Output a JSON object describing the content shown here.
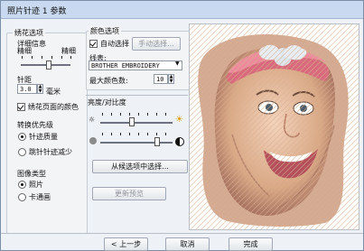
{
  "window": {
    "title": "照片针迹 1 参数"
  },
  "left_group": {
    "title": "绣花选项",
    "fineness_label": "详细信息",
    "fineness_min": "精细",
    "fineness_max": "精细",
    "fineness_value_fraction": 0.55,
    "pitch_label": "针距",
    "pitch_value": "3.0",
    "pitch_unit": "毫米",
    "page_color_label": "绣花页面的颜色",
    "page_color_checked": true,
    "priority_title": "转换优先级",
    "priority_options": [
      "针迹质量",
      "跳针针迹减少"
    ],
    "priority_selected": 0,
    "image_type_title": "图像类型",
    "image_type_options": [
      "照片",
      "卡通画"
    ],
    "image_type_selected": 0
  },
  "color_group": {
    "title": "颜色选项",
    "auto_select_label": "自动选择",
    "auto_select_checked": true,
    "manual_select_label": "手动选择...",
    "thread_label": "线表:",
    "thread_value": "BROTHER EMBROIDERY",
    "max_colors_label": "最大颜色数:",
    "max_colors_value": "10"
  },
  "brightness_group": {
    "title": "亮度/对比度",
    "brightness_value_fraction": 0.42,
    "contrast_value_fraction": 0.78,
    "candidate_button_label": "从候选项中选择...",
    "refresh_button_label": "更新预览"
  },
  "footer": {
    "back_label": "< 上一步",
    "cancel_label": "取消",
    "finish_label": "完成"
  },
  "icons": {
    "dim_sun": "sun-outline-icon",
    "bright_sun": "sun-filled-icon",
    "contrast_low": "gray-circle-icon",
    "contrast_high": "half-circle-icon"
  }
}
